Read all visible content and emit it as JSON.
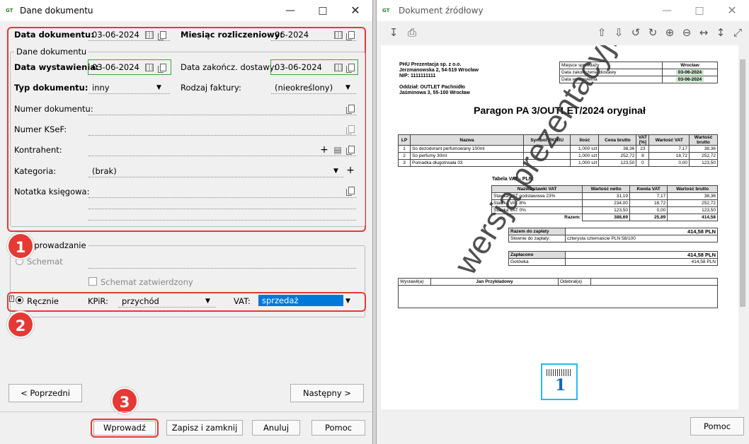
{
  "left_window": {
    "title": "Dane dokumentu",
    "data_dokumentu_label": "Data dokumentu:",
    "data_dokumentu": "03-06-2024",
    "miesiac_label": "Miesiąc rozliczeniowy:",
    "miesiac": "06-2024",
    "group_title": "Dane dokumentu",
    "data_wystawienia_label": "Data wystawienia:",
    "data_wystawienia": "03-06-2024",
    "data_zakoncz_label": "Data zakończ. dostawy:",
    "data_zakoncz": "03-06-2024",
    "typ_label": "Typ dokumentu:",
    "typ": "inny",
    "rodzaj_label": "Rodzaj faktury:",
    "rodzaj": "(nieokreślony)",
    "numer_label": "Numer dokumentu:",
    "ksef_label": "Numer KSeF:",
    "kontrahent_label": "Kontrahent:",
    "kategoria_label": "Kategoria:",
    "kategoria": "(brak)",
    "notatka_label": "Notatka księgowa:",
    "wprowadzanie_title": "Wprowadzanie",
    "schemat_label": "Schemat",
    "schemat_zatw_label": "Schemat zatwierdzony",
    "recznie_label": "Ręcznie",
    "kpir_label": "KPiR:",
    "kpir": "przychód",
    "vat_label": "VAT:",
    "vat": "sprzedaż",
    "poprzedni": "<  Poprzedni",
    "nastepny": "Następny  >",
    "wprowadz": "Wprowadź",
    "zapisz": "Zapisz i zamknij",
    "anuluj": "Anuluj",
    "pomoc": "Pomoc",
    "badges": [
      "1",
      "2",
      "3"
    ]
  },
  "right_window": {
    "title": "Dokument źródłowy",
    "pomoc": "Pomoc"
  },
  "document": {
    "seller_lines": [
      "PHU Prezentacja sp. z o.o.",
      "Jerzmanowska 2, 54-519 Wrocław",
      "NIP: 1111111111"
    ],
    "branch_lines": [
      "Oddział: OUTLET Pachnidło",
      "Jaśminowa 3, 55-100 Wrocław"
    ],
    "info": [
      {
        "k": "Miejsce sprzedaży",
        "v": "Wrocław"
      },
      {
        "k": "Data zakończenia dostawy",
        "v": "03-06-2024"
      },
      {
        "k": "Data wystawienia",
        "v": "03-06-2024"
      }
    ],
    "heading": "Paragon PA 3/OUTLET/2024 oryginał",
    "items_header": [
      "LP",
      "Nazwa",
      "Symbol PKWiU",
      "Ilość",
      "Cena brutto",
      "VAT [%]",
      "Wartość VAT",
      "Wartość brutto"
    ],
    "items": [
      [
        "1",
        "So dezodorant perfumowany 100ml",
        "",
        "1,000 szt",
        "38,36",
        "23",
        "7,17",
        "38,36"
      ],
      [
        "2",
        "So perfumy 30ml",
        "",
        "1,000 szt",
        "252,72",
        "8",
        "18,72",
        "252,72"
      ],
      [
        "3",
        "Pomadka długotrwała 03",
        "",
        "1,000 szt",
        "123,50",
        "0",
        "0,00",
        "123,50"
      ]
    ],
    "vat_title": "Tabela VAT - PLN:",
    "vat_header": [
      "Nazwa stawki VAT",
      "Wartość netto",
      "Kwota VAT",
      "Wartość brutto"
    ],
    "vat_rows": [
      [
        "Stawka VAT podstawowa 23%",
        "31,19",
        "7,17",
        "38,36"
      ],
      [
        "Stawka VAT 8%",
        "234,00",
        "18,72",
        "252,72"
      ],
      [
        "Stawka VAT 0%",
        "123,50",
        "0,00",
        "123,50"
      ]
    ],
    "razem_label": "Razem:",
    "razem": [
      "388,69",
      "25,89",
      "414,58"
    ],
    "do_zaplaty_label": "Razem do zapłaty",
    "do_zaplaty": "414,58 PLN",
    "slownie_label": "Słownie do zapłaty:",
    "slownie": "czterysta czternaście PLN 58/100",
    "zaplacono_label": "Zapłacono",
    "zaplacono": "414,58 PLN",
    "gotowka_label": "Gotówka",
    "gotowka": "414,58 PLN",
    "wystawil_label": "Wystawił(a)",
    "wystawil": "Jan Przykładowy",
    "odebral_label": "Odebrał(a)",
    "watermark": "wersja prezentacyjna"
  }
}
